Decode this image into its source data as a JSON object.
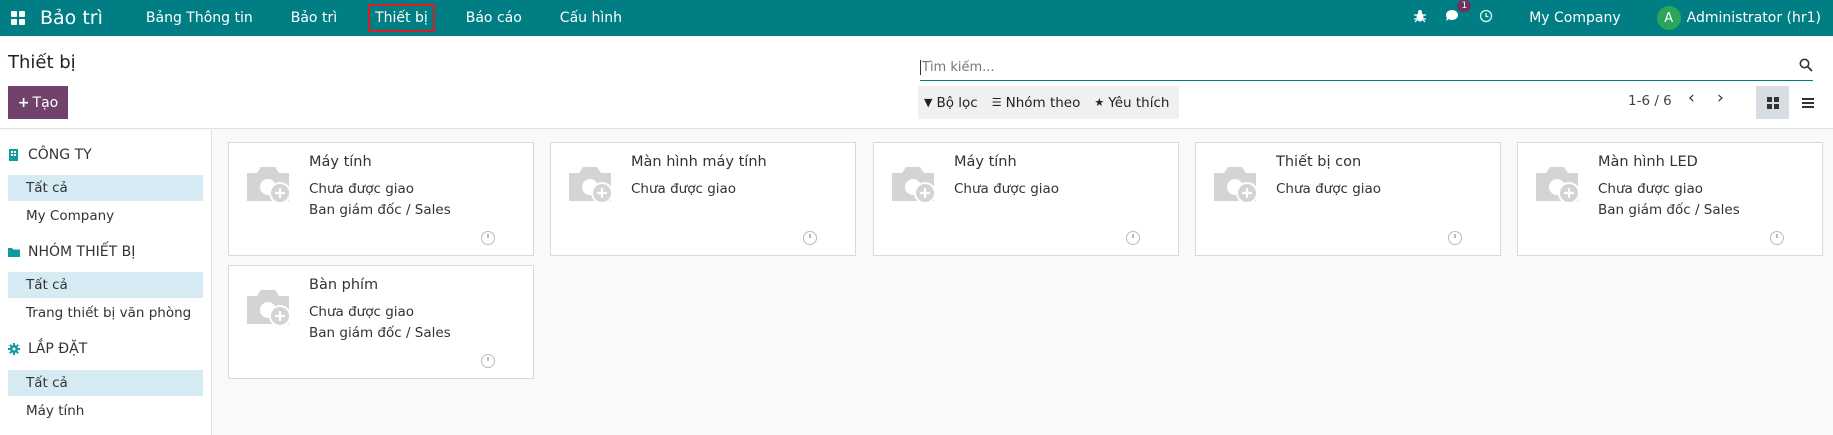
{
  "navbar": {
    "app_name": "Bảo trì",
    "menu": [
      {
        "label": "Bảng Thông tin"
      },
      {
        "label": "Bảo trì"
      },
      {
        "label": "Thiết bị"
      },
      {
        "label": "Báo cáo"
      },
      {
        "label": "Cấu hình"
      }
    ],
    "active_menu": "Thiết bị",
    "messages_count": "1",
    "company": "My Company",
    "avatar_letter": "A",
    "user": "Administrator (hr1)",
    "colors": {
      "navbar": "#017e84",
      "avatar": "#2ba55a",
      "badge": "#6b3264",
      "active_outline": "#e01a22"
    }
  },
  "control_panel": {
    "title": "Thiết bị",
    "create_label": "Tạo",
    "search_placeholder": "Tìm kiếm...",
    "filters": {
      "filter": "Bộ lọc",
      "group_by": "Nhóm theo",
      "favorites": "Yêu thích"
    },
    "pager": "1-6 / 6",
    "active_view": "kanban",
    "colors": {
      "create_button": "#71426b"
    }
  },
  "sidebar": {
    "sections": [
      {
        "title": "CÔNG TY",
        "icon": "building-icon",
        "items": [
          {
            "label": "Tất cả",
            "active": true
          },
          {
            "label": "My Company",
            "active": false
          }
        ]
      },
      {
        "title": "NHÓM THIẾT BỊ",
        "icon": "folder-icon",
        "items": [
          {
            "label": "Tất cả",
            "active": true
          },
          {
            "label": "Trang thiết bị văn phòng",
            "active": false
          }
        ]
      },
      {
        "title": "LẮP ĐẶT",
        "icon": "gear-icon",
        "items": [
          {
            "label": "Tất cả",
            "active": true
          },
          {
            "label": "Máy tính",
            "active": false
          }
        ]
      }
    ]
  },
  "cards": [
    {
      "name": "Máy tính",
      "status": "Chưa được giao",
      "department": "Ban giám đốc / Sales"
    },
    {
      "name": "Màn hình máy tính",
      "status": "Chưa được giao",
      "department": ""
    },
    {
      "name": "Máy tính",
      "status": "Chưa được giao",
      "department": ""
    },
    {
      "name": "Thiết bị con",
      "status": "Chưa được giao",
      "department": ""
    },
    {
      "name": "Màn hình LED",
      "status": "Chưa được giao",
      "department": "Ban giám đốc / Sales"
    },
    {
      "name": "Bàn phím",
      "status": "Chưa được giao",
      "department": "Ban giám đốc / Sales"
    }
  ]
}
